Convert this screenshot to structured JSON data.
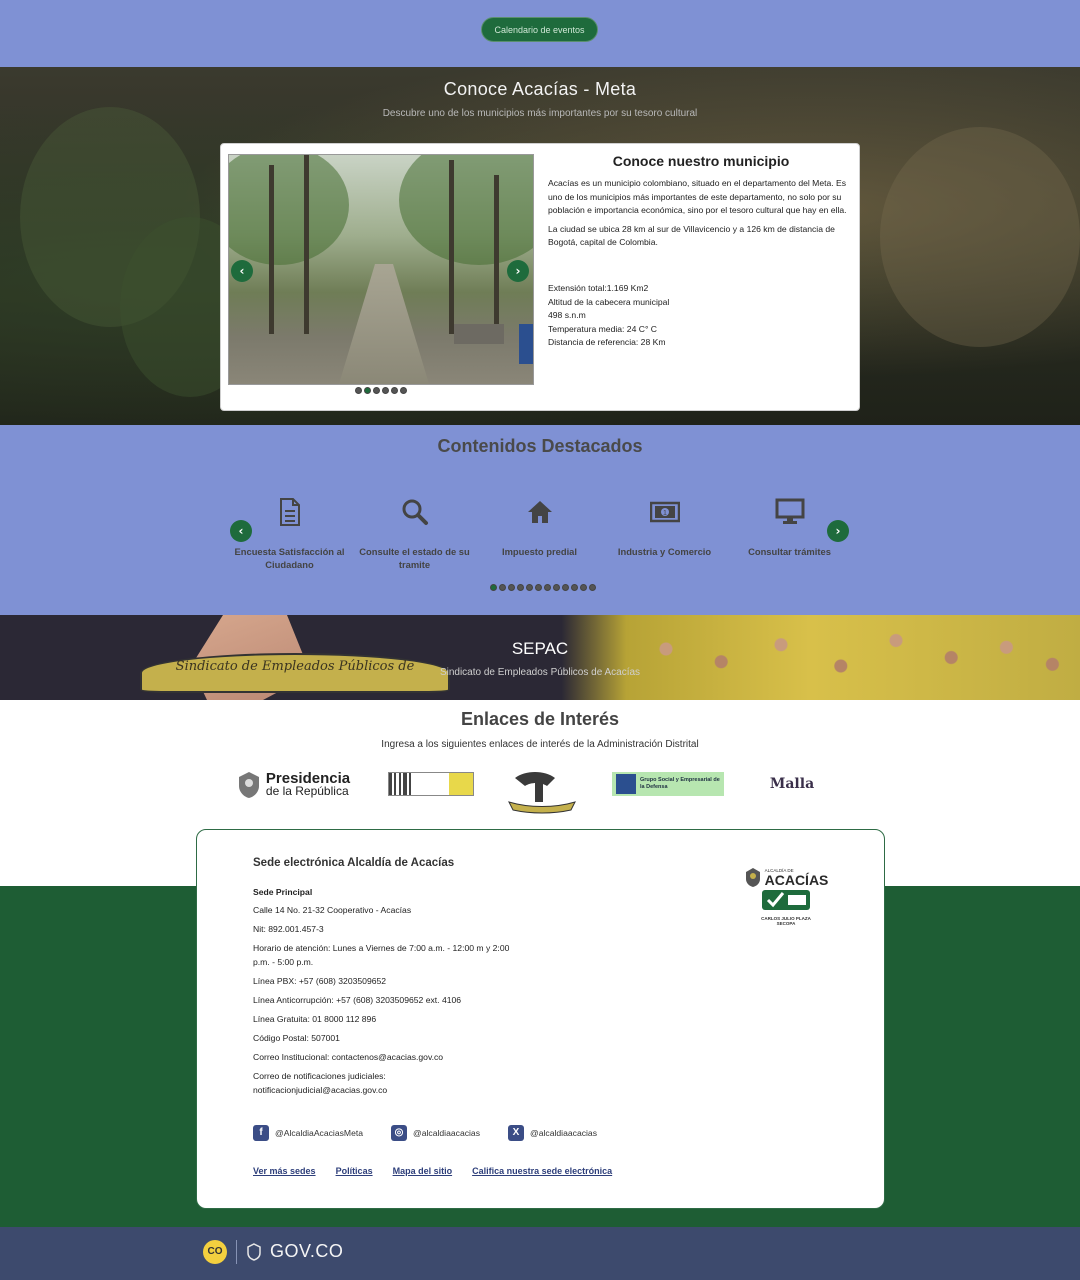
{
  "top": {
    "calendar_button": "Calendario de eventos"
  },
  "hero": {
    "title": "Conoce Acacías - Meta",
    "subtitle": "Descubre uno de los municipios más importantes por su tesoro cultural",
    "card_title": "Conoce nuestro municipio",
    "paragraphs": [
      "Acacías es un municipio colombiano, situado en el departamento del Meta. Es uno de los municipios más importantes de este departamento, no solo por su población e importancia económica, sino por el tesoro cultural que hay en ella.",
      "La ciudad se ubica 28 km al sur de Villavicencio y a 126 km de distancia de Bogotá, capital de Colombia."
    ],
    "facts": [
      "Extensión total:1.169 Km2",
      "Altitud de la cabecera municipal",
      "498 s.n.m",
      "Temperatura media: 24 C° C",
      "Distancia de referencia: 28 Km"
    ],
    "carousel": {
      "total": 6,
      "active": 1
    }
  },
  "destacados": {
    "title": "Contenidos Destacados",
    "items": [
      {
        "icon": "document-icon",
        "label": "Encuesta Satisfacción al Ciudadano"
      },
      {
        "icon": "search-icon",
        "label": "Consulte el estado de su tramite"
      },
      {
        "icon": "home-icon",
        "label": "Impuesto predial"
      },
      {
        "icon": "money-icon",
        "label": "Industria y Comercio"
      },
      {
        "icon": "monitor-icon",
        "label": "Consultar trámites"
      }
    ],
    "pager": {
      "total": 12,
      "active": 0
    }
  },
  "sepac": {
    "title": "SEPAC",
    "subtitle": "Sindicato de Empleados Públicos de Acacías",
    "ribbon_text": "Sindicato de Empleados Públicos de"
  },
  "enlaces": {
    "title": "Enlaces de Interés",
    "subtitle": "Ingresa a los siguientes enlaces de interés de la Administración Distrital",
    "presidencia_line1": "Presidencia",
    "presidencia_line2": "de la República",
    "grupo_social": "Grupo Social y Empresarial de la Defensa",
    "malla": "Malla"
  },
  "sede": {
    "title": "Sede electrónica Alcaldía de Acacías",
    "lines": [
      "Sede Principal",
      "Calle 14 No. 21-32 Cooperativo - Acacías",
      "Nit: 892.001.457-3",
      "Horario de atención: Lunes a Viernes de 7:00 a.m. - 12:00 m y 2:00 p.m. - 5:00 p.m.",
      "Línea PBX: +57 (608) 3203509652",
      "Línea Anticorrupción: +57 (608)  3203509652 ext. 4106",
      "Línea Gratuita: 01 8000 112 896",
      "Código Postal: 507001",
      "Correo Institucional: contactenos@acacias.gov.co",
      "Correo de notificaciones judiciales: notificacionjudicial@acacias.gov.co"
    ],
    "social": [
      {
        "icon": "facebook-icon",
        "glyph": "f",
        "handle": "@AlcaldiaAcaciasMeta"
      },
      {
        "icon": "instagram-icon",
        "glyph": "◎",
        "handle": "@alcaldiaacacias"
      },
      {
        "icon": "x-icon",
        "glyph": "X",
        "handle": "@alcaldiaacacias"
      }
    ],
    "links": [
      "Ver más sedes",
      "Políticas",
      "Mapa del sitio",
      "Califica nuestra sede electrónica"
    ],
    "logo": {
      "small": "ALCALDÍA DE",
      "name": "ACACÍAS",
      "badge": "CARLOS JULIO PLAZA SECOPA"
    }
  },
  "gov": {
    "badge": "CO",
    "text": "GOV.CO"
  }
}
